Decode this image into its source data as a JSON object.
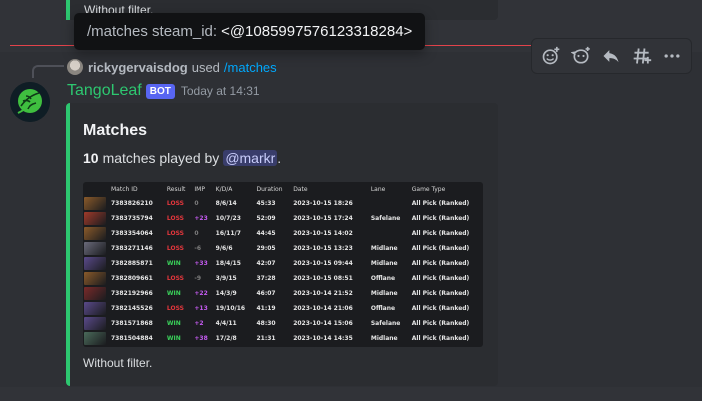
{
  "previous_embed": {
    "footer": "Without filter."
  },
  "tooltip": {
    "command": "/matches steam_id:",
    "mention": "<@1085997576123318284>"
  },
  "toolbar": {
    "icons": [
      "add-reaction-icon",
      "super-reaction-icon",
      "reply-icon",
      "create-thread-icon",
      "more-icon"
    ]
  },
  "reply": {
    "user": "rickygervaisdog",
    "used": "used",
    "command": "/matches"
  },
  "message": {
    "author": "TangoLeaf",
    "bot_tag": "BOT",
    "timestamp": "Today at 14:31",
    "embed": {
      "title": "Matches",
      "count": "10",
      "desc_text": "matches played by",
      "mention": "@markr",
      "desc_end": ".",
      "footer": "Without filter.",
      "table": {
        "columns": [
          "",
          "Match ID",
          "Result",
          "IMP",
          "K/D/A",
          "Duration",
          "Date",
          "Lane",
          "Game Type"
        ],
        "rows": [
          {
            "hero_color": "#8a5a2a",
            "match_id": "7383826210",
            "result": "LOSS",
            "imp": "0",
            "kda": "8/6/14",
            "duration": "45:33",
            "date": "2023-10-15 18:26",
            "lane": "",
            "game_type": "All Pick (Ranked)"
          },
          {
            "hero_color": "#a03a2a",
            "match_id": "7383735794",
            "result": "LOSS",
            "imp": "+23",
            "kda": "10/7/23",
            "duration": "52:09",
            "date": "2023-10-15 17:24",
            "lane": "Safelane",
            "game_type": "All Pick (Ranked)"
          },
          {
            "hero_color": "#8a5a2a",
            "match_id": "7383354064",
            "result": "LOSS",
            "imp": "0",
            "kda": "16/11/7",
            "duration": "44:45",
            "date": "2023-10-15 14:02",
            "lane": "",
            "game_type": "All Pick (Ranked)"
          },
          {
            "hero_color": "#6a6a7a",
            "match_id": "7383271146",
            "result": "LOSS",
            "imp": "-6",
            "kda": "9/6/6",
            "duration": "29:05",
            "date": "2023-10-15 13:23",
            "lane": "Midlane",
            "game_type": "All Pick (Ranked)"
          },
          {
            "hero_color": "#5a4a8a",
            "match_id": "7382885871",
            "result": "WIN",
            "imp": "+33",
            "kda": "18/4/15",
            "duration": "42:07",
            "date": "2023-10-15 09:44",
            "lane": "Midlane",
            "game_type": "All Pick (Ranked)"
          },
          {
            "hero_color": "#8a5a2a",
            "match_id": "7382809661",
            "result": "LOSS",
            "imp": "-9",
            "kda": "3/9/15",
            "duration": "37:28",
            "date": "2023-10-15 08:51",
            "lane": "Offlane",
            "game_type": "All Pick (Ranked)"
          },
          {
            "hero_color": "#7a2a2a",
            "match_id": "7382192966",
            "result": "WIN",
            "imp": "+22",
            "kda": "14/3/9",
            "duration": "46:07",
            "date": "2023-10-14 21:52",
            "lane": "Midlane",
            "game_type": "All Pick (Ranked)"
          },
          {
            "hero_color": "#5a4a8a",
            "match_id": "7382145526",
            "result": "LOSS",
            "imp": "+13",
            "kda": "19/10/16",
            "duration": "41:19",
            "date": "2023-10-14 21:06",
            "lane": "Offlane",
            "game_type": "All Pick (Ranked)"
          },
          {
            "hero_color": "#5a4a8a",
            "match_id": "7381571868",
            "result": "WIN",
            "imp": "+2",
            "kda": "4/4/11",
            "duration": "48:30",
            "date": "2023-10-14 15:06",
            "lane": "Safelane",
            "game_type": "All Pick (Ranked)"
          },
          {
            "hero_color": "#4a6a5a",
            "match_id": "7381504884",
            "result": "WIN",
            "imp": "+38",
            "kda": "17/2/8",
            "duration": "21:31",
            "date": "2023-10-14 14:35",
            "lane": "Midlane",
            "game_type": "All Pick (Ranked)"
          }
        ]
      }
    }
  },
  "colors": {
    "accent": "#2dc770",
    "bot": "#5865f2",
    "command": "#00a8fc",
    "win": "#3ad15a",
    "loss": "#e5373d",
    "imp": "#c45af0"
  }
}
